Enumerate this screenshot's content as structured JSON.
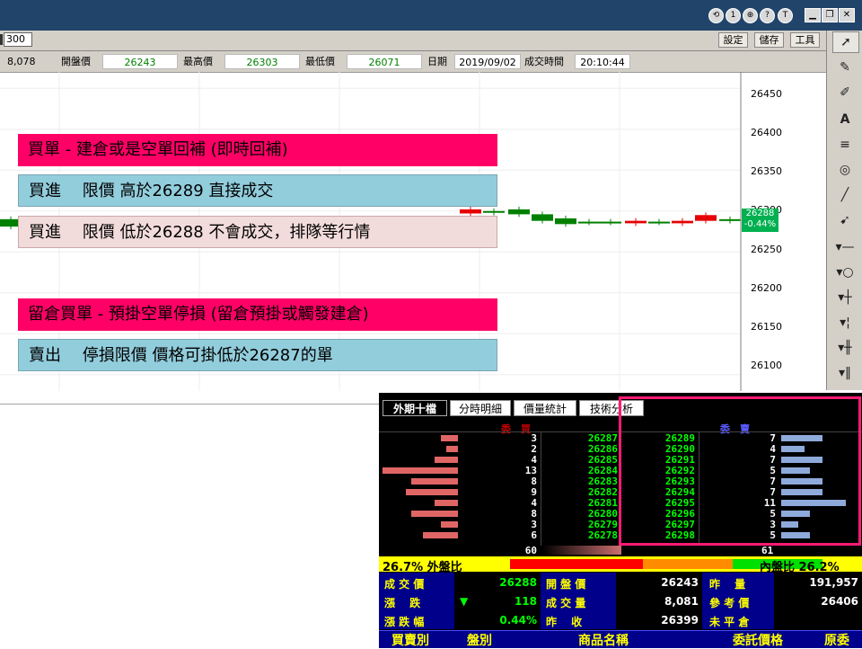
{
  "toolbar": {
    "interval_value": "300",
    "settings_label": "設定",
    "save_label": "儲存",
    "tools_label": "工具"
  },
  "titlebar": {
    "circle_buttons": [
      "⟲",
      "1",
      "⊕",
      "?",
      "T"
    ]
  },
  "info": {
    "volume": "8,078",
    "open_label": "開盤價",
    "open": "26243",
    "high_label": "最高價",
    "high": "26303",
    "low_label": "最低價",
    "low": "26071",
    "date_label": "日期",
    "date": "2019/09/02",
    "time_label": "成交時間",
    "time": "20:10:44"
  },
  "chart": {
    "y_ticks": [
      "26450",
      "26400",
      "26350",
      "26300",
      "26250",
      "26200",
      "26150",
      "26100"
    ],
    "last_price": "26288",
    "last_change": "-0.44%"
  },
  "chart_data": {
    "type": "candlestick",
    "title": "",
    "xlabel": "",
    "ylabel": "",
    "ylim": [
      26080,
      26470
    ],
    "grid": true,
    "last_price": 26288,
    "candles": [
      {
        "open": 26290,
        "close": 26281
      },
      {
        "open": 26281,
        "close": 26283
      },
      {
        "open": 26297,
        "close": 26302
      },
      {
        "open": 26300,
        "close": 26298
      },
      {
        "open": 26302,
        "close": 26296
      },
      {
        "open": 26296,
        "close": 26288
      },
      {
        "open": 26291,
        "close": 26284
      },
      {
        "open": 26287,
        "close": 26286
      },
      {
        "open": 26287,
        "close": 26286
      },
      {
        "open": 26285,
        "close": 26288
      },
      {
        "open": 26287,
        "close": 26286
      },
      {
        "open": 26285,
        "close": 26288
      },
      {
        "open": 26288,
        "close": 26295
      },
      {
        "open": 26290,
        "close": 26288
      }
    ]
  },
  "overlay": {
    "line1": "買單 - 建倉或是空單回補 (即時回補)",
    "line2": "買進　 限價 高於26289 直接成交",
    "line3": "買進　 限價 低於26288 不會成交，排隊等行情",
    "line4": "留倉買單 - 預掛空單停損 (留倉預掛或觸發建倉)",
    "line5": "賣出　 停損限價 價格可掛低於26287的單"
  },
  "panel": {
    "tabs": [
      "外期十檔",
      "分時明細",
      "價量統計",
      "技術分析"
    ],
    "bid_header": "委　買",
    "ask_header": "委　賣",
    "bids": [
      {
        "qty": "3",
        "price": "26287",
        "frac": 0.23
      },
      {
        "qty": "2",
        "price": "26286",
        "frac": 0.15
      },
      {
        "qty": "4",
        "price": "26285",
        "frac": 0.31
      },
      {
        "qty": "13",
        "price": "26284",
        "frac": 1.0
      },
      {
        "qty": "8",
        "price": "26283",
        "frac": 0.62
      },
      {
        "qty": "9",
        "price": "26282",
        "frac": 0.69
      },
      {
        "qty": "4",
        "price": "26281",
        "frac": 0.31
      },
      {
        "qty": "8",
        "price": "26280",
        "frac": 0.62
      },
      {
        "qty": "3",
        "price": "26279",
        "frac": 0.23
      },
      {
        "qty": "6",
        "price": "26278",
        "frac": 0.46
      }
    ],
    "asks": [
      {
        "price": "26289",
        "qty": "7",
        "frac": 0.64
      },
      {
        "price": "26290",
        "qty": "4",
        "frac": 0.36
      },
      {
        "price": "26291",
        "qty": "7",
        "frac": 0.64
      },
      {
        "price": "26292",
        "qty": "5",
        "frac": 0.45
      },
      {
        "price": "26293",
        "qty": "7",
        "frac": 0.64
      },
      {
        "price": "26294",
        "qty": "7",
        "frac": 0.64
      },
      {
        "price": "26295",
        "qty": "11",
        "frac": 1.0
      },
      {
        "price": "26296",
        "qty": "5",
        "frac": 0.45
      },
      {
        "price": "26297",
        "qty": "3",
        "frac": 0.27
      },
      {
        "price": "26298",
        "qty": "5",
        "frac": 0.45
      }
    ],
    "bid_total": "60",
    "ask_total": "61",
    "outer_label": "26.7% 外盤比",
    "inner_label": "內盤比 26.2%",
    "stats": {
      "last_label": "成 交 價",
      "last": "26288",
      "open_label": "開 盤 價",
      "open": "26243",
      "prevvol_label": "昨　 量",
      "prevvol": "191,957",
      "chg_label": "漲　 跌",
      "chg_arrow": "▼",
      "chg": "118",
      "vol_label": "成 交 量",
      "vol": "8,081",
      "ref_label": "參 考 價",
      "ref": "26406",
      "pct_label": "漲 跌 幅",
      "pct": "0.44%",
      "prevclose_label": "昨　 收",
      "prevclose": "26399",
      "unclosed_label": "未 平 倉",
      "unclosed": ""
    },
    "orders_header": [
      "買賣別",
      "盤別",
      "商品名稱",
      "委託價格",
      "原委"
    ]
  },
  "colors": {
    "up": "#e60000",
    "down": "#008000",
    "panel_green": "#00ff00",
    "highlight": "#ff1a75"
  }
}
